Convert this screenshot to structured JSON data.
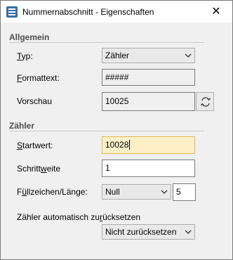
{
  "window": {
    "title": "Nummernabschnitt - Eigenschaften",
    "close_icon": "close-icon"
  },
  "sections": {
    "general": "Allgemein",
    "counter": "Zähler"
  },
  "general": {
    "type_label_pre": "",
    "type_label_ul": "T",
    "type_label_post": "yp:",
    "type_value": "Zähler",
    "format_label_ul": "F",
    "format_label_post": "ormattext:",
    "format_value": "#####",
    "preview_label": "Vorschau",
    "preview_value": "10025",
    "refresh_icon": "refresh-icon"
  },
  "counter": {
    "start_label_ul": "S",
    "start_label_post": "tartwert:",
    "start_value": "10028",
    "step_label_pre": "Schritt",
    "step_label_ul": "w",
    "step_label_post": "eite",
    "step_value": "1",
    "fill_label_pre": "F",
    "fill_label_ul": "ü",
    "fill_label_post": "llzeichen/Länge:",
    "fill_value": "Null",
    "length_value": "5",
    "reset_label_pre": "Zähler automatisch zu",
    "reset_label_ul": "r",
    "reset_label_post": "ücksetzen",
    "reset_value": "Nicht zurücksetzen"
  }
}
